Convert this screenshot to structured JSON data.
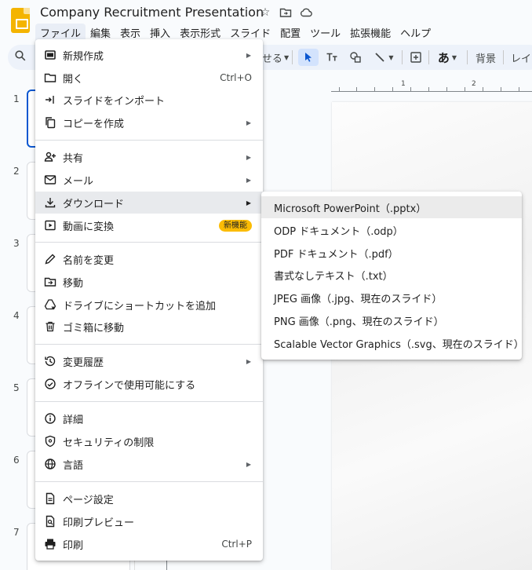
{
  "app": {
    "title": "Company Recruitment Presentation"
  },
  "menubar": [
    "ファイル",
    "編集",
    "表示",
    "挿入",
    "表示形式",
    "スライド",
    "配置",
    "ツール",
    "拡張機能",
    "ヘルプ"
  ],
  "toolbar": {
    "partial_label": "せる",
    "background": "背景",
    "layout": "レイ",
    "text_style": "あ"
  },
  "ruler": {
    "label_1": "1",
    "label_2": "2"
  },
  "slides": {
    "numbers": [
      "1",
      "2",
      "3",
      "4",
      "5",
      "6",
      "7"
    ]
  },
  "file_menu": {
    "items": [
      {
        "label": "新規作成",
        "icon": "new-slides-icon",
        "submenu": true
      },
      {
        "label": "開く",
        "icon": "folder-icon",
        "shortcut": "Ctrl+O"
      },
      {
        "label": "スライドをインポート",
        "icon": "import-icon"
      },
      {
        "label": "コピーを作成",
        "icon": "copy-icon",
        "submenu": true
      },
      {
        "label": "共有",
        "icon": "person-add-icon",
        "submenu": true
      },
      {
        "label": "メール",
        "icon": "mail-icon",
        "submenu": true
      },
      {
        "label": "ダウンロード",
        "icon": "download-icon",
        "submenu": true
      },
      {
        "label": "動画に変換",
        "icon": "video-icon",
        "badge": "新機能"
      },
      {
        "label": "名前を変更",
        "icon": "pencil-icon"
      },
      {
        "label": "移動",
        "icon": "folder-move-icon"
      },
      {
        "label": "ドライブにショートカットを追加",
        "icon": "drive-shortcut-icon"
      },
      {
        "label": "ゴミ箱に移動",
        "icon": "trash-icon"
      },
      {
        "label": "変更履歴",
        "icon": "history-icon",
        "submenu": true
      },
      {
        "label": "オフラインで使用可能にする",
        "icon": "offline-icon"
      },
      {
        "label": "詳細",
        "icon": "info-icon"
      },
      {
        "label": "セキュリティの制限",
        "icon": "shield-icon"
      },
      {
        "label": "言語",
        "icon": "globe-icon",
        "submenu": true
      },
      {
        "label": "ページ設定",
        "icon": "page-icon"
      },
      {
        "label": "印刷プレビュー",
        "icon": "print-preview-icon"
      },
      {
        "label": "印刷",
        "icon": "print-icon",
        "shortcut": "Ctrl+P"
      }
    ]
  },
  "download_submenu": {
    "items": [
      "Microsoft PowerPoint（.pptx）",
      "ODP ドキュメント（.odp）",
      "PDF ドキュメント（.pdf）",
      "書式なしテキスト（.txt）",
      "JPEG 画像（.jpg、現在のスライド）",
      "PNG 画像（.png、現在のスライド）",
      "Scalable Vector Graphics（.svg、現在のスライド）"
    ]
  },
  "colors": {
    "accent": "#0b57d0",
    "badge": "#fbbc04",
    "logo": "#f4b400"
  }
}
